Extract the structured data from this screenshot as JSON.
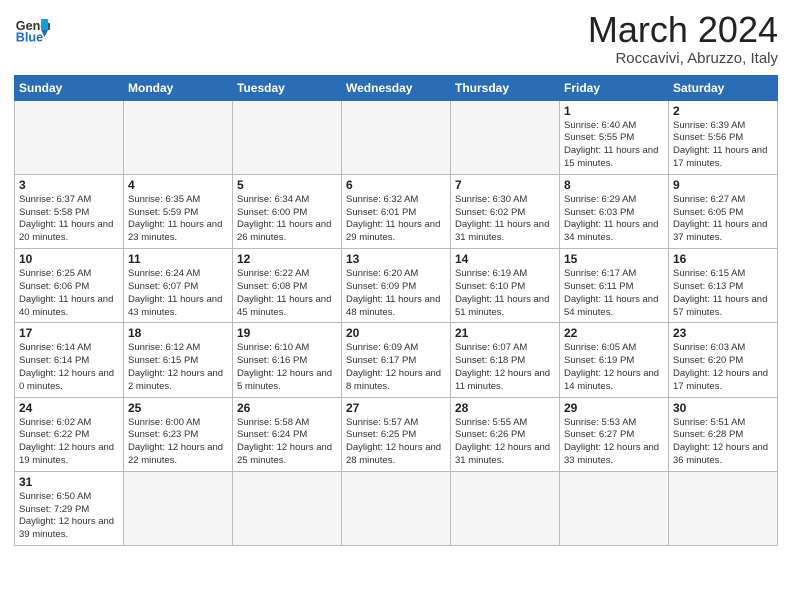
{
  "logo": {
    "text_general": "General",
    "text_blue": "Blue"
  },
  "title": "March 2024",
  "subtitle": "Roccavivi, Abruzzo, Italy",
  "days_of_week": [
    "Sunday",
    "Monday",
    "Tuesday",
    "Wednesday",
    "Thursday",
    "Friday",
    "Saturday"
  ],
  "weeks": [
    [
      {
        "day": "",
        "info": "",
        "empty": true
      },
      {
        "day": "",
        "info": "",
        "empty": true
      },
      {
        "day": "",
        "info": "",
        "empty": true
      },
      {
        "day": "",
        "info": "",
        "empty": true
      },
      {
        "day": "",
        "info": "",
        "empty": true
      },
      {
        "day": "1",
        "info": "Sunrise: 6:40 AM\nSunset: 5:55 PM\nDaylight: 11 hours and 15 minutes."
      },
      {
        "day": "2",
        "info": "Sunrise: 6:39 AM\nSunset: 5:56 PM\nDaylight: 11 hours and 17 minutes."
      }
    ],
    [
      {
        "day": "3",
        "info": "Sunrise: 6:37 AM\nSunset: 5:58 PM\nDaylight: 11 hours and 20 minutes."
      },
      {
        "day": "4",
        "info": "Sunrise: 6:35 AM\nSunset: 5:59 PM\nDaylight: 11 hours and 23 minutes."
      },
      {
        "day": "5",
        "info": "Sunrise: 6:34 AM\nSunset: 6:00 PM\nDaylight: 11 hours and 26 minutes."
      },
      {
        "day": "6",
        "info": "Sunrise: 6:32 AM\nSunset: 6:01 PM\nDaylight: 11 hours and 29 minutes."
      },
      {
        "day": "7",
        "info": "Sunrise: 6:30 AM\nSunset: 6:02 PM\nDaylight: 11 hours and 31 minutes."
      },
      {
        "day": "8",
        "info": "Sunrise: 6:29 AM\nSunset: 6:03 PM\nDaylight: 11 hours and 34 minutes."
      },
      {
        "day": "9",
        "info": "Sunrise: 6:27 AM\nSunset: 6:05 PM\nDaylight: 11 hours and 37 minutes."
      }
    ],
    [
      {
        "day": "10",
        "info": "Sunrise: 6:25 AM\nSunset: 6:06 PM\nDaylight: 11 hours and 40 minutes."
      },
      {
        "day": "11",
        "info": "Sunrise: 6:24 AM\nSunset: 6:07 PM\nDaylight: 11 hours and 43 minutes."
      },
      {
        "day": "12",
        "info": "Sunrise: 6:22 AM\nSunset: 6:08 PM\nDaylight: 11 hours and 45 minutes."
      },
      {
        "day": "13",
        "info": "Sunrise: 6:20 AM\nSunset: 6:09 PM\nDaylight: 11 hours and 48 minutes."
      },
      {
        "day": "14",
        "info": "Sunrise: 6:19 AM\nSunset: 6:10 PM\nDaylight: 11 hours and 51 minutes."
      },
      {
        "day": "15",
        "info": "Sunrise: 6:17 AM\nSunset: 6:11 PM\nDaylight: 11 hours and 54 minutes."
      },
      {
        "day": "16",
        "info": "Sunrise: 6:15 AM\nSunset: 6:13 PM\nDaylight: 11 hours and 57 minutes."
      }
    ],
    [
      {
        "day": "17",
        "info": "Sunrise: 6:14 AM\nSunset: 6:14 PM\nDaylight: 12 hours and 0 minutes."
      },
      {
        "day": "18",
        "info": "Sunrise: 6:12 AM\nSunset: 6:15 PM\nDaylight: 12 hours and 2 minutes."
      },
      {
        "day": "19",
        "info": "Sunrise: 6:10 AM\nSunset: 6:16 PM\nDaylight: 12 hours and 5 minutes."
      },
      {
        "day": "20",
        "info": "Sunrise: 6:09 AM\nSunset: 6:17 PM\nDaylight: 12 hours and 8 minutes."
      },
      {
        "day": "21",
        "info": "Sunrise: 6:07 AM\nSunset: 6:18 PM\nDaylight: 12 hours and 11 minutes."
      },
      {
        "day": "22",
        "info": "Sunrise: 6:05 AM\nSunset: 6:19 PM\nDaylight: 12 hours and 14 minutes."
      },
      {
        "day": "23",
        "info": "Sunrise: 6:03 AM\nSunset: 6:20 PM\nDaylight: 12 hours and 17 minutes."
      }
    ],
    [
      {
        "day": "24",
        "info": "Sunrise: 6:02 AM\nSunset: 6:22 PM\nDaylight: 12 hours and 19 minutes."
      },
      {
        "day": "25",
        "info": "Sunrise: 6:00 AM\nSunset: 6:23 PM\nDaylight: 12 hours and 22 minutes."
      },
      {
        "day": "26",
        "info": "Sunrise: 5:58 AM\nSunset: 6:24 PM\nDaylight: 12 hours and 25 minutes."
      },
      {
        "day": "27",
        "info": "Sunrise: 5:57 AM\nSunset: 6:25 PM\nDaylight: 12 hours and 28 minutes."
      },
      {
        "day": "28",
        "info": "Sunrise: 5:55 AM\nSunset: 6:26 PM\nDaylight: 12 hours and 31 minutes."
      },
      {
        "day": "29",
        "info": "Sunrise: 5:53 AM\nSunset: 6:27 PM\nDaylight: 12 hours and 33 minutes."
      },
      {
        "day": "30",
        "info": "Sunrise: 5:51 AM\nSunset: 6:28 PM\nDaylight: 12 hours and 36 minutes."
      }
    ],
    [
      {
        "day": "31",
        "info": "Sunrise: 6:50 AM\nSunset: 7:29 PM\nDaylight: 12 hours and 39 minutes."
      },
      {
        "day": "",
        "info": "",
        "empty": true
      },
      {
        "day": "",
        "info": "",
        "empty": true
      },
      {
        "day": "",
        "info": "",
        "empty": true
      },
      {
        "day": "",
        "info": "",
        "empty": true
      },
      {
        "day": "",
        "info": "",
        "empty": true
      },
      {
        "day": "",
        "info": "",
        "empty": true
      }
    ]
  ]
}
